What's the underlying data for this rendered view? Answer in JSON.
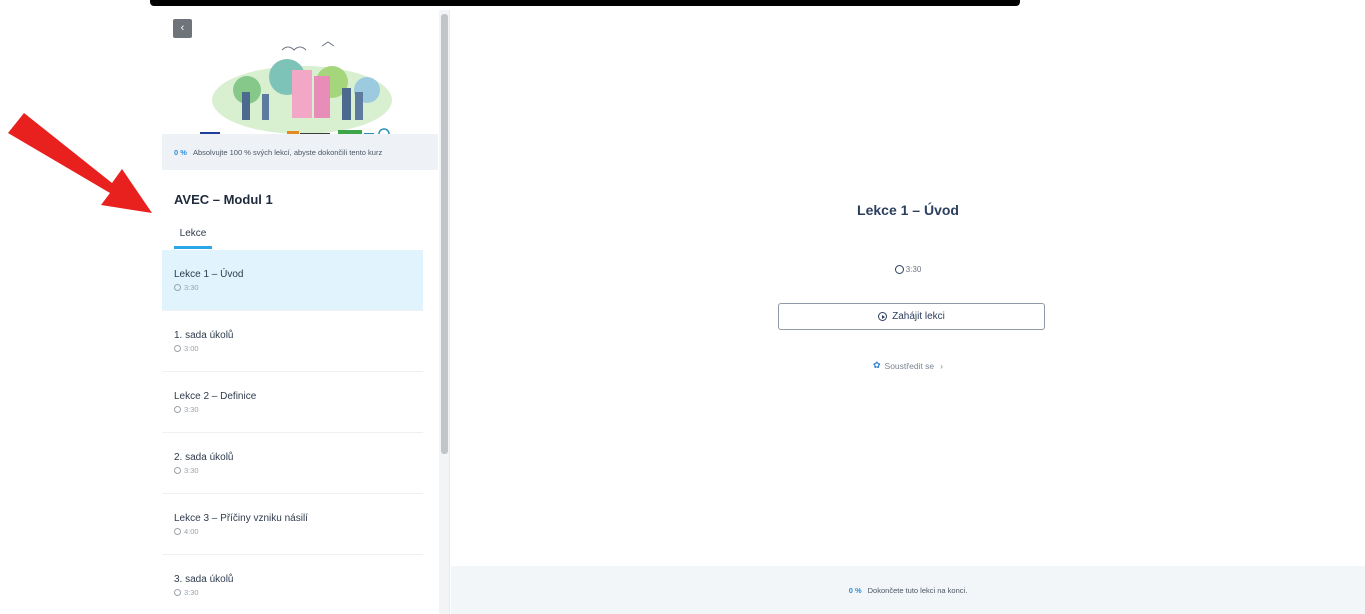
{
  "sidebar": {
    "back_icon": "chevron-left-icon",
    "progress": {
      "percent": "0 %",
      "text": "Absolvujte 100 % svých lekcí, abyste dokončili tento kurz"
    },
    "module_title": "AVEC – Modul 1",
    "tab_label": "Lekce",
    "lessons": [
      {
        "title": "Lekce 1 – Úvod",
        "duration": "3:30",
        "active": true
      },
      {
        "title": "1. sada úkolů",
        "duration": "3:00"
      },
      {
        "title": "Lekce 2 – Definice",
        "duration": "3:30"
      },
      {
        "title": "2. sada úkolů",
        "duration": "3:30"
      },
      {
        "title": "Lekce 3 – Příčiny vzniku násilí",
        "duration": "4:00"
      },
      {
        "title": "3. sada úkolů",
        "duration": "3:30"
      }
    ]
  },
  "main": {
    "lesson_title": "Lekce 1 – Úvod",
    "duration": "3:30",
    "start_label": "Zahájit lekci",
    "focus_label": "Soustředit se",
    "footer": {
      "percent": "0 %",
      "text": "Dokončete tuto lekci na konci."
    }
  },
  "colors": {
    "accent": "#2aa7e8",
    "active_bg": "#e1f3fd",
    "heading": "#2c3f5e",
    "arrow": "#e8201e"
  }
}
